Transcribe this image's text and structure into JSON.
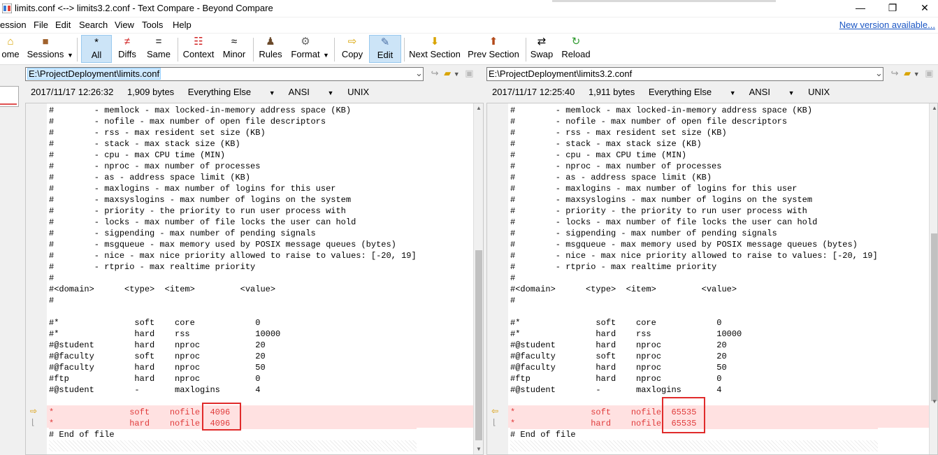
{
  "window": {
    "title": "limits.conf <--> limits3.2.conf - Text Compare - Beyond Compare",
    "minimize": "—",
    "maximize": "❐",
    "close": "✕"
  },
  "menu": {
    "items": [
      "ession",
      "File",
      "Edit",
      "Search",
      "View",
      "Tools",
      "Help"
    ],
    "new_version": "New version available..."
  },
  "toolbar": {
    "home": "ome",
    "sessions": "Sessions",
    "all": "All",
    "diffs": "Diffs",
    "same": "Same",
    "context": "Context",
    "minor": "Minor",
    "rules": "Rules",
    "format": "Format",
    "copy": "Copy",
    "edit": "Edit",
    "next_section": "Next Section",
    "prev_section": "Prev Section",
    "swap": "Swap",
    "reload": "Reload"
  },
  "left": {
    "path": "E:\\ProjectDeployment\\limits.conf",
    "timestamp": "2017/11/17 12:26:32",
    "size": "1,909 bytes",
    "filter": "Everything Else",
    "encoding": "ANSI",
    "lineend": "UNIX",
    "diff_line1": "*               soft    nofile  4096",
    "diff_line2": "*               hard    nofile  4096"
  },
  "right": {
    "path": "E:\\ProjectDeployment\\limits3.2.conf",
    "timestamp": "2017/11/17 12:25:40",
    "size": "1,911 bytes",
    "filter": "Everything Else",
    "encoding": "ANSI",
    "lineend": "UNIX",
    "diff_line1": "*               soft    nofile  65535",
    "diff_line2": "*               hard    nofile  65535"
  },
  "common_lines": [
    "#        - memlock - max locked-in-memory address space (KB)",
    "#        - nofile - max number of open file descriptors",
    "#        - rss - max resident set size (KB)",
    "#        - stack - max stack size (KB)",
    "#        - cpu - max CPU time (MIN)",
    "#        - nproc - max number of processes",
    "#        - as - address space limit (KB)",
    "#        - maxlogins - max number of logins for this user",
    "#        - maxsyslogins - max number of logins on the system",
    "#        - priority - the priority to run user process with",
    "#        - locks - max number of file locks the user can hold",
    "#        - sigpending - max number of pending signals",
    "#        - msgqueue - max memory used by POSIX message queues (bytes)",
    "#        - nice - max nice priority allowed to raise to values: [-20, 19]",
    "#        - rtprio - max realtime priority",
    "#",
    "#<domain>      <type>  <item>         <value>",
    "#",
    "",
    "#*               soft    core            0",
    "#*               hard    rss             10000",
    "#@student        hard    nproc           20",
    "#@faculty        soft    nproc           20",
    "#@faculty        hard    nproc           50",
    "#ftp             hard    nproc           0",
    "#@student        -       maxlogins       4",
    ""
  ],
  "end_line": "# End of file"
}
